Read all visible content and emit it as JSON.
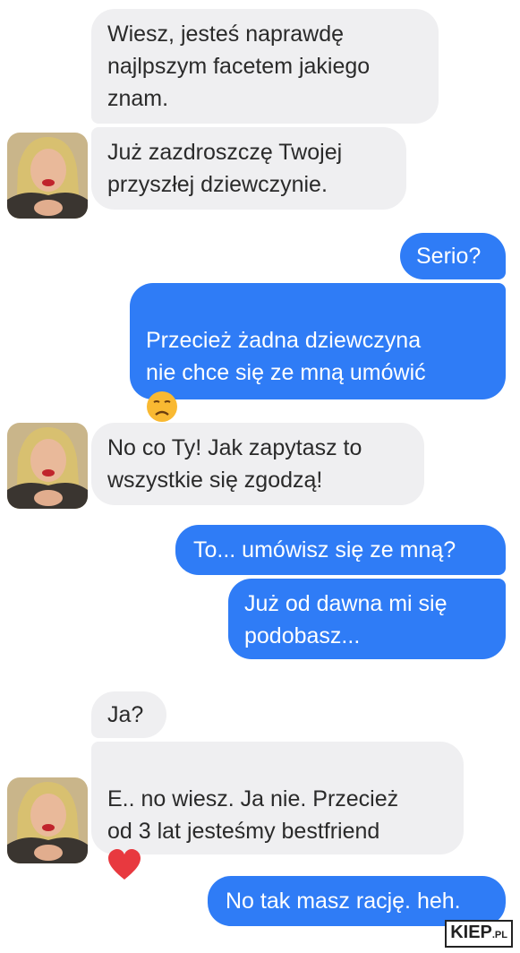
{
  "messages": [
    {
      "side": "in",
      "text": "Wiesz, jesteś naprawdę\nnajlpszym facetem jakiego\nznam."
    },
    {
      "side": "in",
      "text": "Już zazdroszczę Twojej\nprzyszłej dziewczynie."
    },
    {
      "side": "out",
      "text": "Serio?"
    },
    {
      "side": "out",
      "text": "Przecież żadna dziewczyna\nnie chce się ze mną umówić",
      "emoji": "sad-face-emoji"
    },
    {
      "side": "in",
      "text": "No co Ty! Jak zapytasz to\nwszystkie się zgodzą!"
    },
    {
      "side": "out",
      "text": "To... umówisz się ze mną?"
    },
    {
      "side": "out",
      "text": "Już od dawna mi się\npodobasz..."
    },
    {
      "side": "in",
      "text": "Ja?"
    },
    {
      "side": "in",
      "text": "E.. no wiesz. Ja nie. Przecież\nod 3 lat jesteśmy bestfriend",
      "emoji": "heart-emoji"
    },
    {
      "side": "out",
      "text": "No tak masz rację. heh."
    }
  ],
  "colors": {
    "outgoing": "#2f7cf6",
    "incoming": "#efeff1"
  },
  "watermark": {
    "main": "KIEP",
    "suffix": ".PL"
  }
}
